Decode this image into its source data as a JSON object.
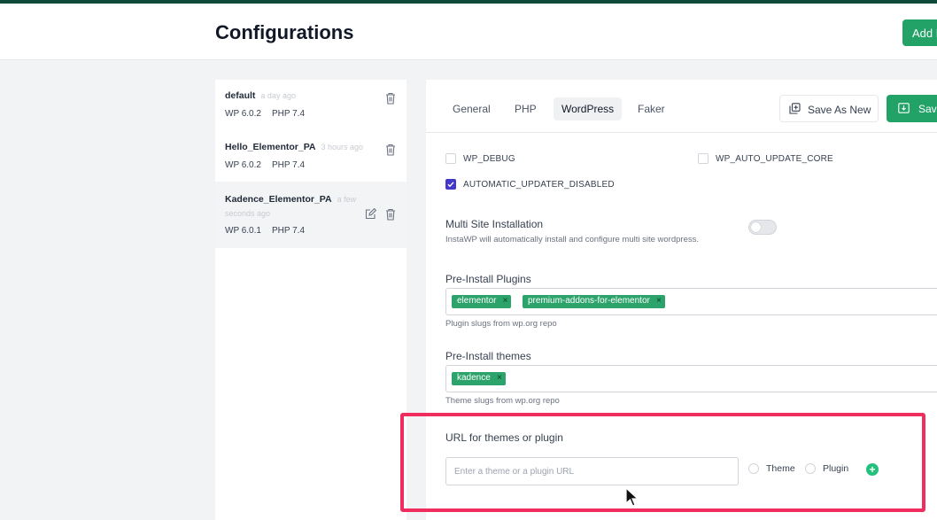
{
  "header": {
    "title": "Configurations",
    "add_new_label": "Add New"
  },
  "configs": [
    {
      "name": "default",
      "time": "a day ago",
      "wp": "WP 6.0.2",
      "php": "PHP 7.4"
    },
    {
      "name": "Hello_Elementor_PA",
      "time": "3 hours ago",
      "wp": "WP 6.0.2",
      "php": "PHP 7.4"
    },
    {
      "name": "Kadence_Elementor_PA",
      "time": "a few seconds ago",
      "wp": "WP 6.0.1",
      "php": "PHP 7.4"
    }
  ],
  "tabs": [
    "General",
    "PHP",
    "WordPress",
    "Faker"
  ],
  "active_tab": "WordPress",
  "actions": {
    "save_as_new": "Save As New",
    "save": "Save"
  },
  "checkboxes": [
    {
      "label": "WP_DEBUG",
      "checked": false
    },
    {
      "label": "WP_AUTO_UPDATE_CORE",
      "checked": false
    },
    {
      "label": "AUTOMATIC_UPDATER_DISABLED",
      "checked": true
    }
  ],
  "multisite": {
    "title": "Multi Site Installation",
    "description": "InstaWP will automatically install and configure multi site wordpress.",
    "enabled": false
  },
  "plugins": {
    "title": "Pre-Install Plugins",
    "tags": [
      "elementor",
      "premium-addons-for-elementor"
    ],
    "help": "Plugin slugs from wp.org repo"
  },
  "themes": {
    "title": "Pre-Install themes",
    "tags": [
      "kadence"
    ],
    "help": "Theme slugs from wp.org repo"
  },
  "url_section": {
    "title": "URL for themes or plugin",
    "placeholder": "Enter a theme or a plugin URL",
    "radio_theme": "Theme",
    "radio_plugin": "Plugin",
    "add_symbol": "+"
  },
  "colors": {
    "brand_green": "#22a267",
    "checkbox_checked": "#4338ca",
    "highlight_box": "#ef2d5e",
    "top_accent": "#0d4a3a"
  }
}
